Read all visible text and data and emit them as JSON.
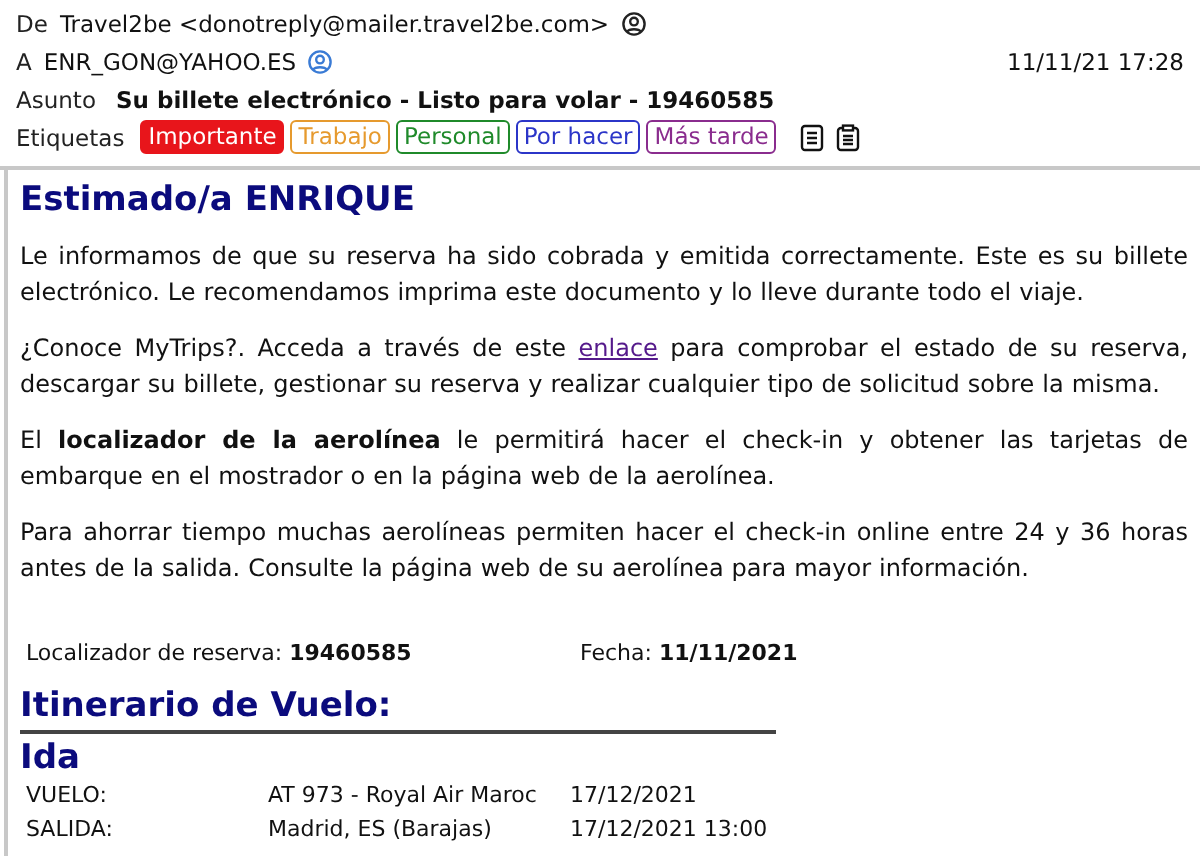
{
  "header": {
    "from_label": "De",
    "from": "Travel2be <donotreply@mailer.travel2be.com>",
    "to_label": "A",
    "to": "ENR_GON@YAHOO.ES",
    "date": "11/11/21 17:28",
    "subject_label": "Asunto",
    "subject": "Su billete electrónico - Listo para volar - 19460585",
    "tags_label": "Etiquetas",
    "tags": [
      {
        "label": "Importante",
        "color": "#e8151b",
        "kind": "filled"
      },
      {
        "label": "Trabajo",
        "color": "#e69a2e",
        "kind": "outline"
      },
      {
        "label": "Personal",
        "color": "#1f8a2a",
        "kind": "outline"
      },
      {
        "label": "Por hacer",
        "color": "#2b35c8",
        "kind": "outline"
      },
      {
        "label": "Más tarde",
        "color": "#8a2c8e",
        "kind": "outline"
      }
    ]
  },
  "body": {
    "greeting": "Estimado/a ENRIQUE",
    "paragraphs": [
      {
        "kind": "text",
        "text": "Le informamos de que su reserva ha sido cobrada y emitida correctamente. Este es su billete electrónico. Le recomendamos imprima este documento y lo lleve durante todo el viaje."
      },
      {
        "kind": "link",
        "text": "¿Conoce MyTrips?. Acceda a través de este",
        "link": "enlace",
        "after": "para comprobar el estado de su reserva, descargar su billete, gestionar su reserva y realizar cualquier tipo de solicitud sobre la misma."
      },
      {
        "kind": "text",
        "text": "El **localizador de la aerolínea** le permitirá hacer el check-in y obtener las tarjetas de embarque en el mostrador o en la página web de la aerolínea."
      },
      {
        "kind": "text",
        "text": "Para ahorrar tiempo muchas aerolíneas permiten hacer el check-in online entre 24 y 36 horas antes de la salida. Consulte la página web de su aerolínea para mayor información."
      }
    ],
    "booking": {
      "locator_label": "Localizador de reserva:",
      "locator": "19460585",
      "date_label": "Fecha:",
      "date": "11/11/2021"
    },
    "itinerary_title": "Itinerario de Vuelo:",
    "leg_title": "Ida",
    "rows": [
      {
        "label": "VUELO:",
        "value": "AT 973 - Royal Air Maroc",
        "date": "17/12/2021"
      },
      {
        "label": "SALIDA:",
        "value": "Madrid, ES (Barajas)",
        "date": "17/12/2021 13:00"
      }
    ]
  }
}
